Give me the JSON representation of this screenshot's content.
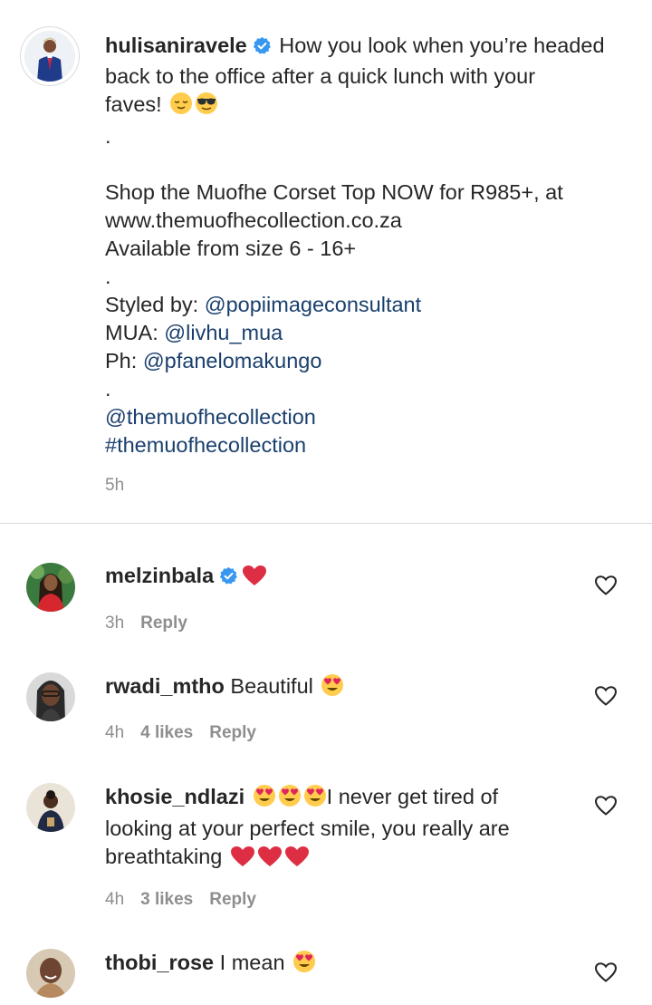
{
  "post": {
    "username": "hulisaniravele",
    "caption_first": "How you look when you’re headed",
    "caption_lines": [
      "back to the office after a quick lunch with your",
      "faves!"
    ],
    "dot1": ".",
    "shop_line1": "Shop the Muofhe Corset Top NOW for R985+, at",
    "shop_line2": "www.themuofhecollection.co.za",
    "shop_line3": "Available from size 6 - 16+",
    "dot2": ".",
    "styled_label": "Styled by:",
    "styled_handle": "@popiimageconsultant",
    "mua_label": "MUA:",
    "mua_handle": "@livhu_mua",
    "ph_label": "Ph:",
    "ph_handle": "@pfanelomakungo",
    "dot3": ".",
    "brand_handle": "@themuofhecollection",
    "hashtag": "#themuofhecollection",
    "time": "5h"
  },
  "comments": [
    {
      "username": "melzinbala",
      "verified": true,
      "text": "",
      "time": "3h",
      "likes": "",
      "reply": "Reply"
    },
    {
      "username": "rwadi_mtho",
      "text": "Beautiful",
      "time": "4h",
      "likes": "4 likes",
      "reply": "Reply"
    },
    {
      "username": "khosie_ndlazi",
      "text1": "I never get tired of",
      "text2": "looking at your perfect smile, you really are",
      "text3": "breathtaking",
      "time": "4h",
      "likes": "3 likes",
      "reply": "Reply"
    },
    {
      "username": "thobi_rose",
      "text": "I mean",
      "time": "",
      "likes": "",
      "reply": ""
    }
  ],
  "icons": {
    "verified": "verified-badge-icon",
    "like": "heart-outline-icon",
    "colors": {
      "verified": "#3897f0",
      "heart": "#ed1c24",
      "link": "#1a3f6d",
      "meta": "#8e8e8e"
    }
  }
}
